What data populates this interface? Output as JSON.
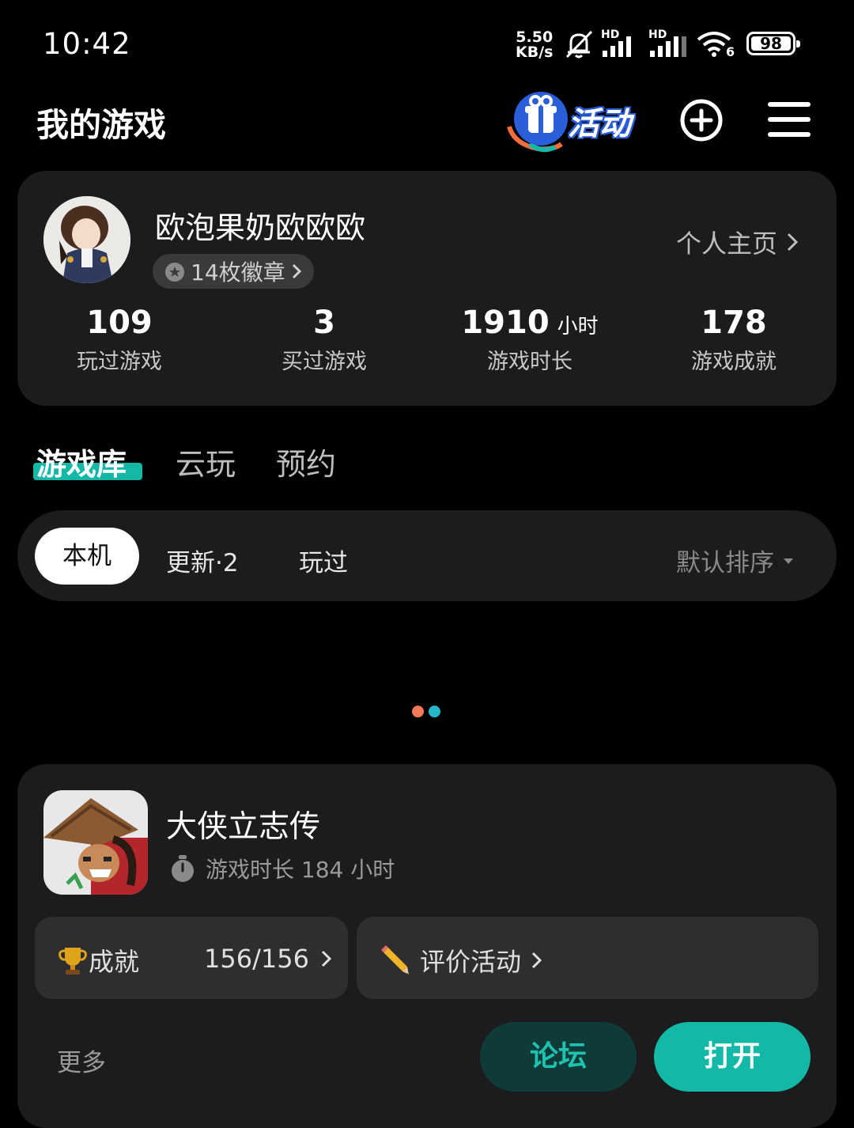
{
  "status_bar": {
    "time": "10:42",
    "net_speed_value": "5.50",
    "net_speed_unit": "KB/s",
    "signal1_label": "HD",
    "signal2_label": "HD",
    "wifi_label": "6",
    "battery": "98"
  },
  "header": {
    "title": "我的游戏",
    "activity_label": "活动",
    "add_icon": "plus-circle-icon",
    "menu_icon": "hamburger-menu-icon"
  },
  "profile": {
    "username": "欧泡果奶欧欧欧",
    "badges": "14枚徽章",
    "homepage_link": "个人主页",
    "stats": [
      {
        "value": "109",
        "unit": "",
        "label": "玩过游戏"
      },
      {
        "value": "3",
        "unit": "",
        "label": "买过游戏"
      },
      {
        "value": "1910",
        "unit": "小时",
        "label": "游戏时长"
      },
      {
        "value": "178",
        "unit": "",
        "label": "游戏成就"
      }
    ]
  },
  "tabs": [
    {
      "label": "游戏库",
      "active": true
    },
    {
      "label": "云玩",
      "active": false
    },
    {
      "label": "预约",
      "active": false
    }
  ],
  "filters": {
    "chips": [
      "本机",
      "更新·2",
      "玩过"
    ],
    "selected": "本机",
    "sort": "默认排序"
  },
  "carousel": {
    "dot_colors": [
      "#f2795a",
      "#22b8c9"
    ]
  },
  "game": {
    "name": "大侠立志传",
    "playtime": "游戏时长 184 小时",
    "achievement_label": "成就",
    "achievement_value": "156/156",
    "review_label": "评价活动",
    "more": "更多",
    "forum_button": "论坛",
    "open_button": "打开"
  },
  "colors": {
    "accent": "#14b8a6",
    "card_bg": "#1c1c1e",
    "forum_bg": "#0e3b38",
    "forum_text": "#1fc2b0"
  }
}
